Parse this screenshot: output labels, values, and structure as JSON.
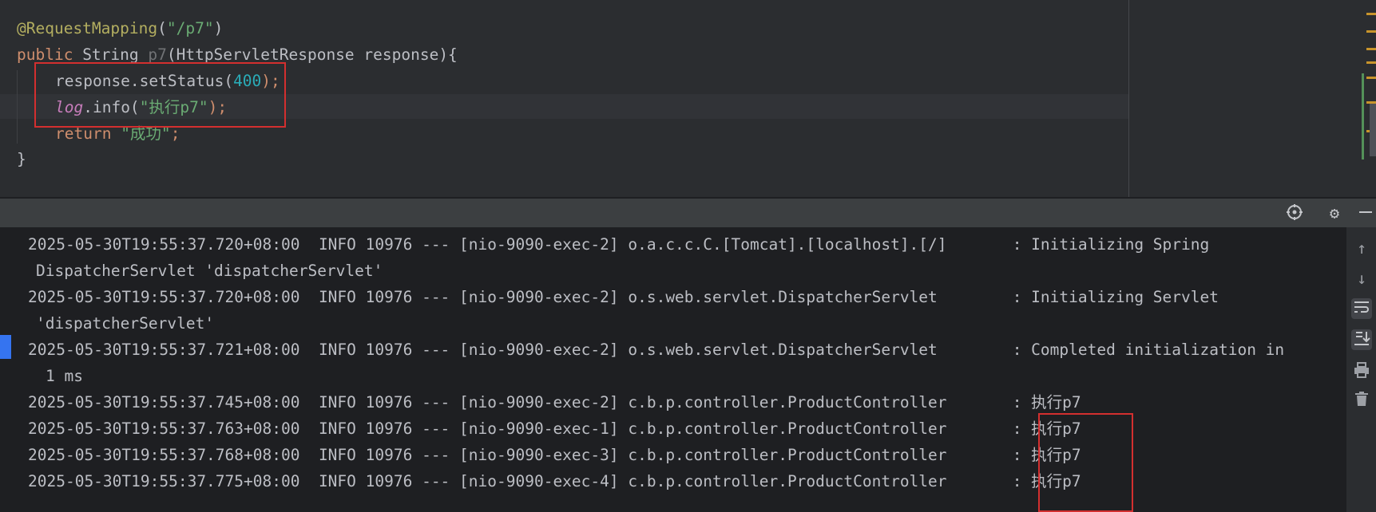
{
  "editor": {
    "lines": [
      {
        "annotation": "@RequestMapping",
        "open": "(",
        "path": "\"/p7\"",
        "close": ")"
      },
      {
        "kw": "public",
        "type": " String ",
        "method": "p7",
        "params": "(HttpServletResponse response){"
      },
      {
        "obj": "response",
        "call": ".setStatus(",
        "num": "400",
        "end": ");"
      },
      {
        "log": "log",
        "call": ".info(",
        "str": "\"执行p7\"",
        "end": ");"
      },
      {
        "kw": "return",
        "str": " \"成功\"",
        "end": ";"
      },
      {
        "brace": "}"
      }
    ]
  },
  "console": {
    "header_icons": [
      "crosshair-icon",
      "gear-icon",
      "minimize-icon"
    ],
    "lines": [
      "2025-05-30T19:55:37.720+08:00  INFO 10976 --- [nio-9090-exec-2] o.a.c.c.C.[Tomcat].[localhost].[/]       : Initializing Spring",
      "DispatcherServlet 'dispatcherServlet'",
      "2025-05-30T19:55:37.720+08:00  INFO 10976 --- [nio-9090-exec-2] o.s.web.servlet.DispatcherServlet        : Initializing Servlet",
      "'dispatcherServlet'",
      "2025-05-30T19:55:37.721+08:00  INFO 10976 --- [nio-9090-exec-2] o.s.web.servlet.DispatcherServlet        : Completed initialization in",
      "1 ms",
      "2025-05-30T19:55:37.745+08:00  INFO 10976 --- [nio-9090-exec-2] c.b.p.controller.ProductController       : 执行p7",
      "2025-05-30T19:55:37.763+08:00  INFO 10976 --- [nio-9090-exec-1] c.b.p.controller.ProductController       : 执行p7",
      "2025-05-30T19:55:37.768+08:00  INFO 10976 --- [nio-9090-exec-3] c.b.p.controller.ProductController       : 执行p7",
      "2025-05-30T19:55:37.775+08:00  INFO 10976 --- [nio-9090-exec-4] c.b.p.controller.ProductController       : 执行p7"
    ],
    "toolbar_icons": [
      "arrow-up-icon",
      "arrow-down-icon",
      "soft-wrap-icon",
      "scroll-to-end-icon",
      "print-icon",
      "trash-icon"
    ]
  },
  "colors": {
    "highlight_box": "#d32f2f",
    "editor_bg": "#2b2d30",
    "console_bg": "#1e1f22"
  }
}
